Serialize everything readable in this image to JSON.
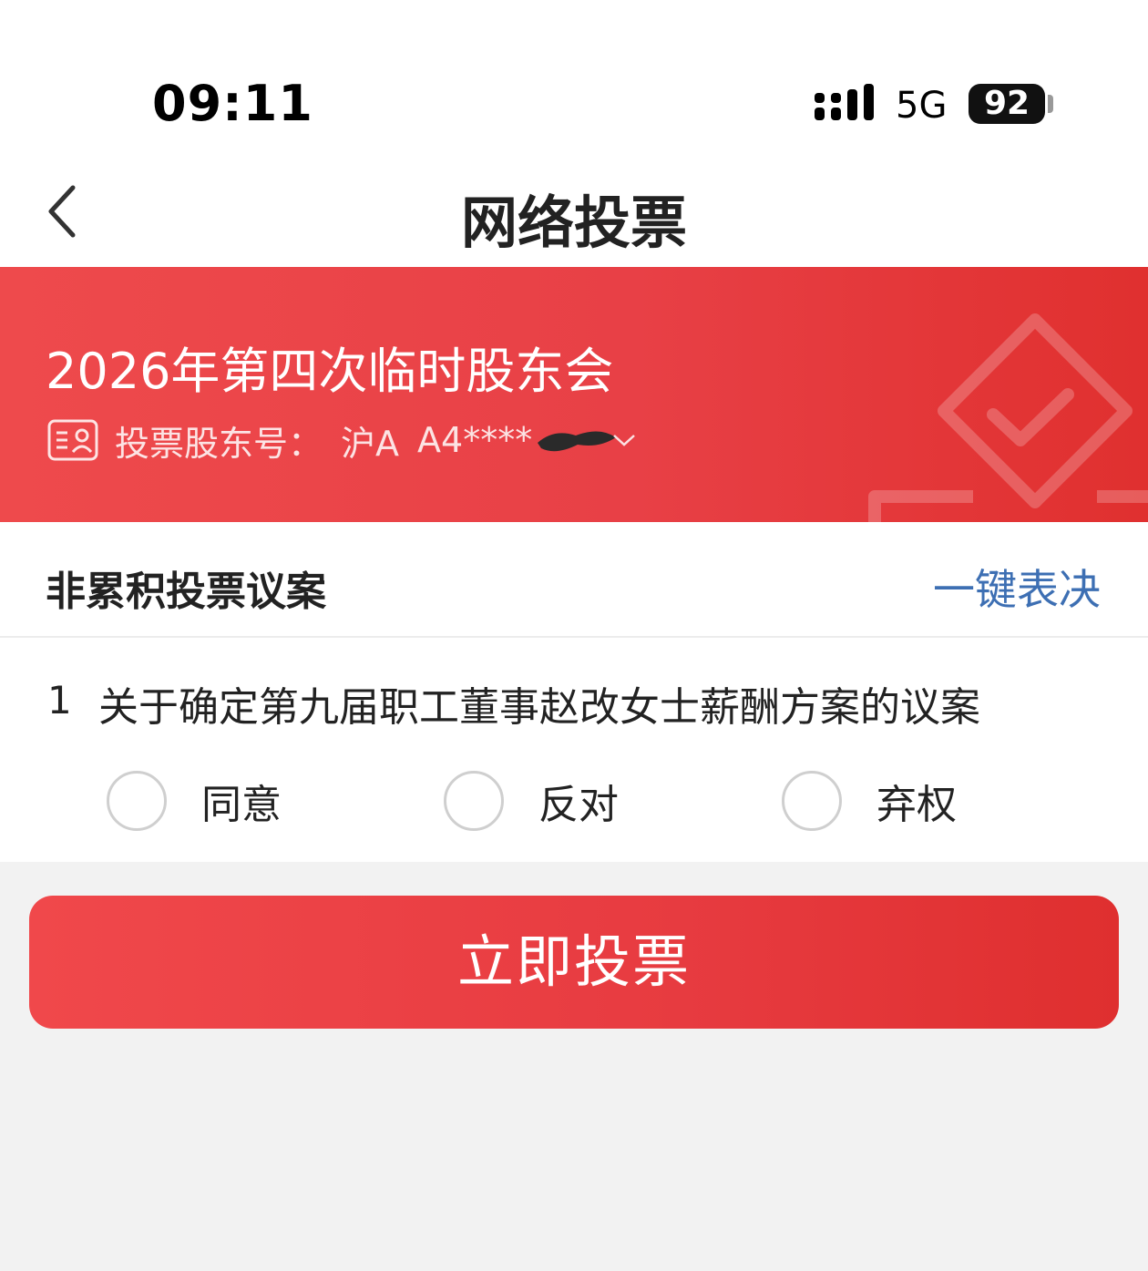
{
  "status_bar": {
    "time": "09:11",
    "network": "5G",
    "battery": "92"
  },
  "nav": {
    "title": "网络投票"
  },
  "banner": {
    "meeting_title": "2026年第四次临时股东会",
    "account_label": "投票股东号：",
    "account_market": "沪A",
    "account_number": "A4****"
  },
  "section": {
    "title": "非累积投票议案",
    "one_click_label": "一键表决"
  },
  "proposals": [
    {
      "index": "1",
      "text": "关于确定第九届职工董事赵改女士薪酬方案的议案",
      "options": [
        "同意",
        "反对",
        "弃权"
      ]
    }
  ],
  "submit": {
    "label": "立即投票"
  },
  "colors": {
    "brand_red": "#e84046",
    "link_blue": "#3d6fb3",
    "page_bg": "#f2f2f2"
  }
}
